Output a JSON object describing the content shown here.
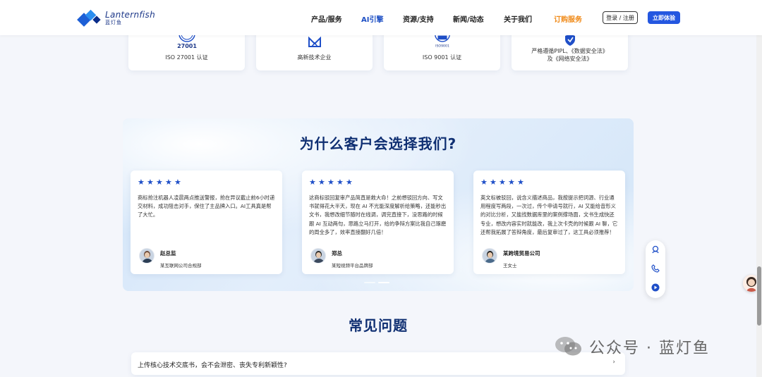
{
  "header": {
    "logo_en": "Lanternfish",
    "logo_cn": "蓝灯鱼",
    "nav": [
      {
        "label": "产品/服务",
        "state": "normal"
      },
      {
        "label": "AI引擎",
        "state": "active"
      },
      {
        "label": "资源/支持",
        "state": "normal"
      },
      {
        "label": "新闻/动态",
        "state": "normal"
      },
      {
        "label": "关于我们",
        "state": "normal"
      },
      {
        "label": "订购服务",
        "state": "highlight"
      }
    ],
    "login_label": "登录 / 注册",
    "try_label": "立即体验"
  },
  "certs": [
    {
      "icon": "iso-27001-icon",
      "badge": "27001",
      "label": "ISO 27001 认证"
    },
    {
      "icon": "high-tech-enterprise-icon",
      "label": "高新技术企业"
    },
    {
      "icon": "iso-9001-icon",
      "badge": "ISO9001",
      "label": "ISO 9001 认证"
    },
    {
      "icon": "shield-icon",
      "label_line1": "严格遵循PIPL、《数据安全法》",
      "label_line2": "及《网络安全法》"
    }
  ],
  "why": {
    "title": "为什么客户会选择我们?",
    "reviews": [
      {
        "stars": 5,
        "text": "商标抢注机器人凌晨两点推送警报，抢在异议截止前6小时递交材料，成功阻击对手，保住了主品牌入口。AI工具真是帮了大忙。",
        "name": "赵总监",
        "org": "某互联网公司合规部"
      },
      {
        "stars": 5,
        "text": "这商标驳回复审产品简直是救大命！之前想驳回方向、写文书就得花大半天，现在 AI 不光能深度解析给策略，还能秒出文书，我想改细节随时在线调，调完直接下，没思路的时候跟 AI 互动两句，思路立马打开，给的争辩方案比我自己琢磨的周全多了，效率直接翻好几倍！",
        "name": "郑总",
        "org": "某短视频平台品牌部"
      },
      {
        "stars": 5,
        "text": "英文标被驳回，说含义描述商品，我按提示把词源、行业通用程度写两段，一次过，传个申请号就行，AI 又能给音形义的对比分析，又能找数据库里的案例撑场面，文书生成快还专业，想改内容实时就能改，我上次卡壳的时候跟 AI 聊，它还帮我拓展了答辩角度，最后复审过了，这工具必须推荐！",
        "name": "某跨境贸易公司",
        "org": "王女士"
      }
    ]
  },
  "faq": {
    "title": "常见问题",
    "items": [
      {
        "question": "上传核心技术交底书，会不会泄密、丧失专利新颖性?"
      }
    ]
  },
  "watermark": {
    "text": "公众号 · 蓝灯鱼"
  },
  "colors": {
    "brand_blue": "#2457e0",
    "nav_active": "#1d4fc4",
    "nav_highlight": "#f08a18",
    "title_navy": "#0f2f72",
    "star_blue": "#1f4fc8"
  }
}
